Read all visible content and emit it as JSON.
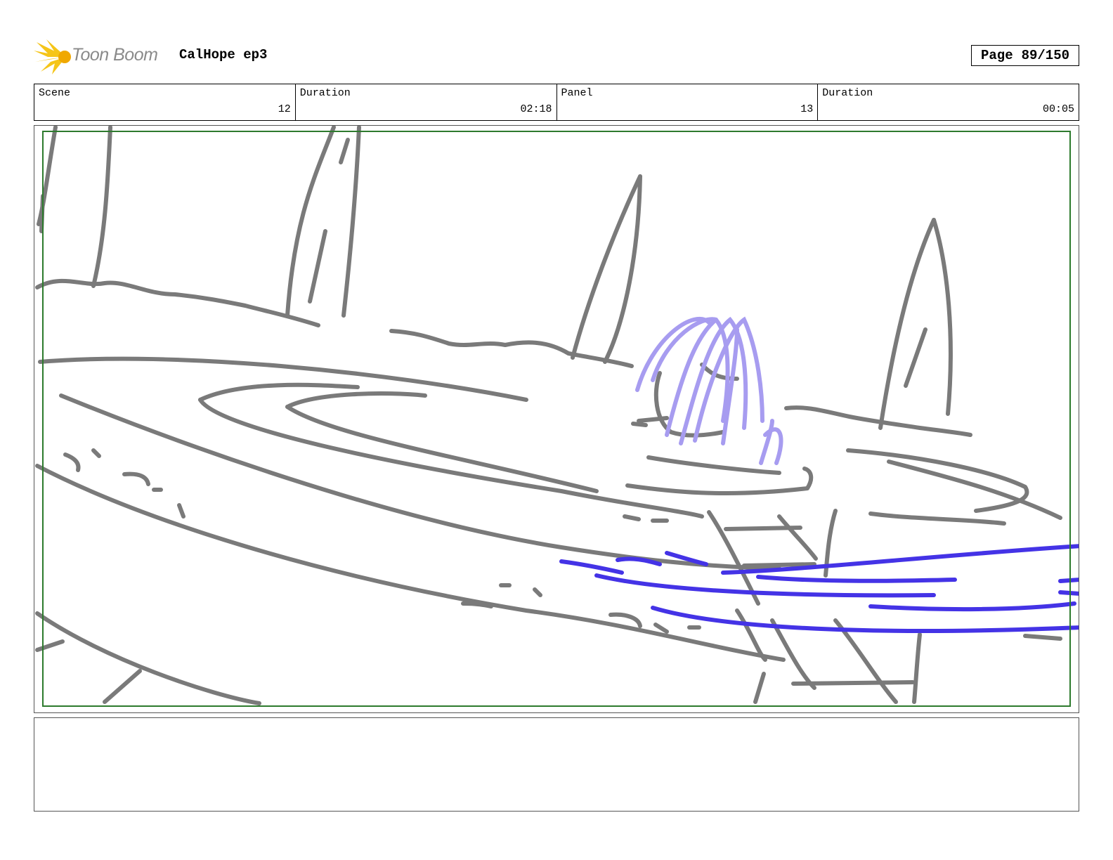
{
  "header": {
    "logo_text": "Toon Boom",
    "project_title": "CalHope ep3",
    "page_label": "Page",
    "page_value": "89/150"
  },
  "info": {
    "scene_label": "Scene",
    "scene_value": "12",
    "scene_duration_label": "Duration",
    "scene_duration_value": "02:18",
    "panel_label": "Panel",
    "panel_value": "13",
    "panel_duration_label": "Duration",
    "panel_duration_value": "00:05"
  },
  "colors": {
    "sketch_gray": "#7a7a7a",
    "water_light": "#a79cf0",
    "water_blue": "#4433e6",
    "safe_frame": "#2d7a2d",
    "logo_yellow": "#f5c518"
  },
  "notes": {
    "text": ""
  }
}
